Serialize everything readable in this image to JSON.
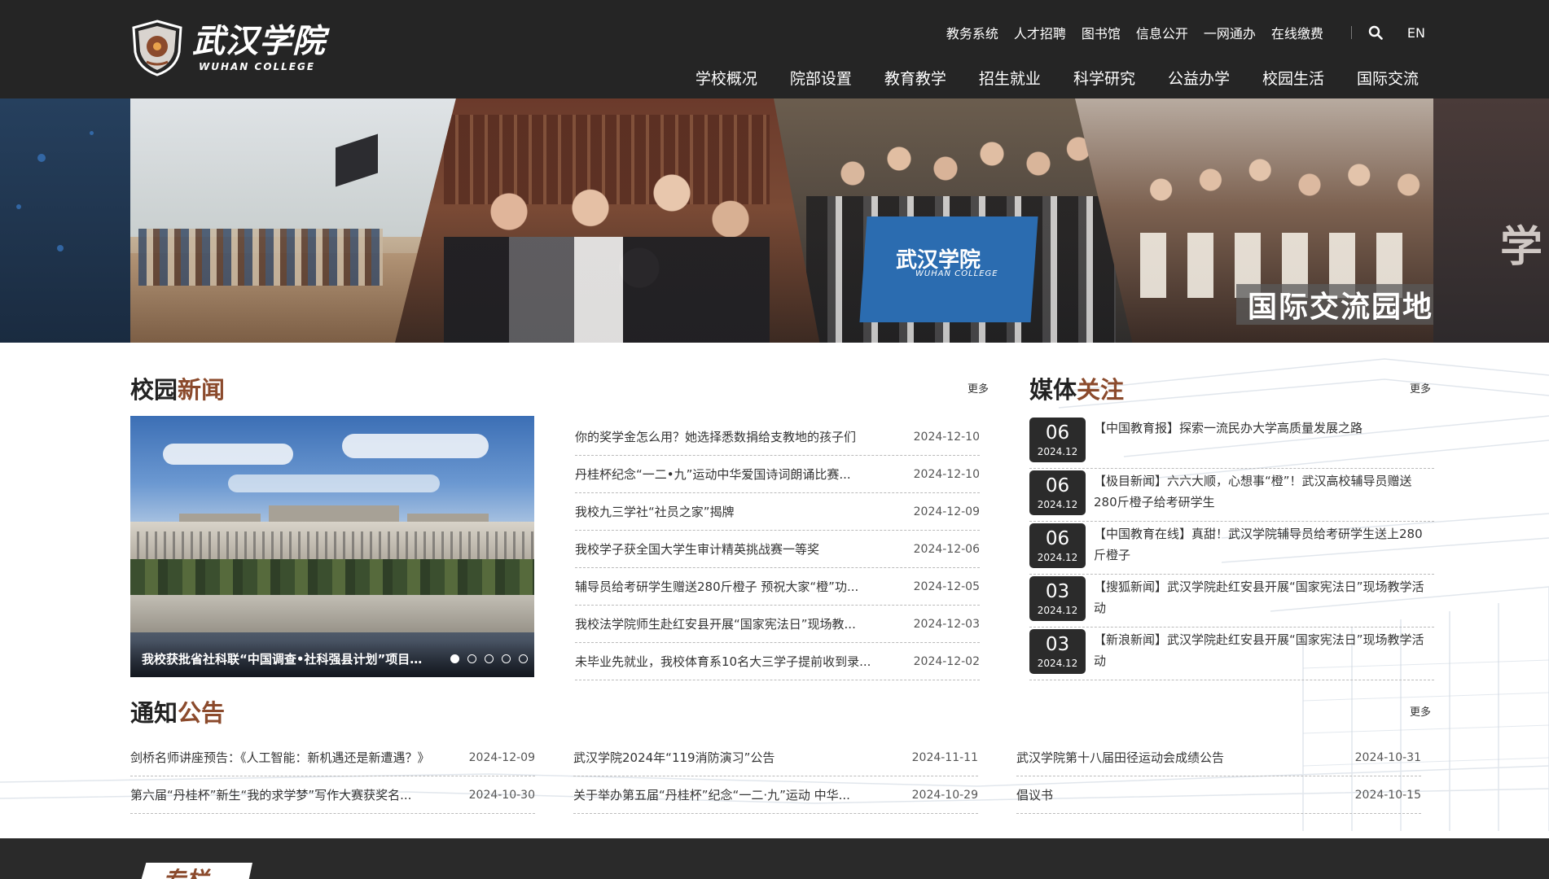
{
  "brand": {
    "name_cn": "武汉学院",
    "name_en": "WUHAN COLLEGE",
    "primary_bg": "#252525",
    "accent": "#8b4a2c"
  },
  "util_nav": {
    "items": [
      "教务系统",
      "人才招聘",
      "图书馆",
      "信息公开",
      "一网通办",
      "在线缴费"
    ],
    "search_icon": "search-icon",
    "lang": "EN"
  },
  "main_nav": {
    "items": [
      "学校概况",
      "院部设置",
      "教育教学",
      "招生就业",
      "科学研究",
      "公益办学",
      "校园生活",
      "国际交流"
    ]
  },
  "banner": {
    "caption": "国际交流园地>>>",
    "flag_text": "武汉学院",
    "flag_sub": "WUHAN COLLEGE",
    "side_char": "学"
  },
  "campus_news": {
    "title_a": "校园",
    "title_b": "新闻",
    "more": "更多",
    "slider_caption": "我校获批省社科联“中国调查•社科强县计划”项目…",
    "slider_dots": 5,
    "items": [
      {
        "title": "你的奖学金怎么用？她选择悉数捐给支教地的孩子们",
        "date": "2024-12-10"
      },
      {
        "title": "丹桂杯纪念“一二•九”运动中华爱国诗词朗诵比赛...",
        "date": "2024-12-10"
      },
      {
        "title": "我校九三学社“社员之家”揭牌",
        "date": "2024-12-09"
      },
      {
        "title": "我校学子获全国大学生审计精英挑战赛一等奖",
        "date": "2024-12-06"
      },
      {
        "title": "辅导员给考研学生赠送280斤橙子 预祝大家“橙”功...",
        "date": "2024-12-05"
      },
      {
        "title": "我校法学院师生赴红安县开展“国家宪法日”现场教...",
        "date": "2024-12-03"
      },
      {
        "title": "未毕业先就业，我校体育系10名大三学子提前收到录...",
        "date": "2024-12-02"
      }
    ]
  },
  "media": {
    "title_a": "媒体",
    "title_b": "关注",
    "more": "更多",
    "items": [
      {
        "day": "06",
        "ym": "2024.12",
        "text": "【中国教育报】探索一流民办大学高质量发展之路"
      },
      {
        "day": "06",
        "ym": "2024.12",
        "text": "【极目新闻】六六大顺，心想事“橙”！武汉高校辅导员赠送280斤橙子给考研学生"
      },
      {
        "day": "06",
        "ym": "2024.12",
        "text": "【中国教育在线】真甜！武汉学院辅导员给考研学生送上280斤橙子"
      },
      {
        "day": "03",
        "ym": "2024.12",
        "text": "【搜狐新闻】武汉学院赴红安县开展“国家宪法日”现场教学活动"
      },
      {
        "day": "03",
        "ym": "2024.12",
        "text": "【新浪新闻】武汉学院赴红安县开展“国家宪法日”现场教学活动"
      }
    ]
  },
  "notice": {
    "title_a": "通知",
    "title_b": "公告",
    "more": "更多",
    "rows": [
      [
        {
          "title": "剑桥名师讲座预告：《人工智能：新机遇还是新遭遇？》",
          "date": "2024-12-09"
        },
        {
          "title": "武汉学院2024年“119消防演习”公告",
          "date": "2024-11-11"
        },
        {
          "title": "武汉学院第十八届田径运动会成绩公告",
          "date": "2024-10-31"
        }
      ],
      [
        {
          "title": "第六届“丹桂杯”新生“我的求学梦”写作大赛获奖名...",
          "date": "2024-10-30"
        },
        {
          "title": "关于举办第五届“丹桂杯”纪念“一二·九”运动 中华...",
          "date": "2024-10-29"
        },
        {
          "title": "倡议书",
          "date": "2024-10-15"
        }
      ]
    ]
  },
  "footer": {
    "tab": "专栏"
  }
}
